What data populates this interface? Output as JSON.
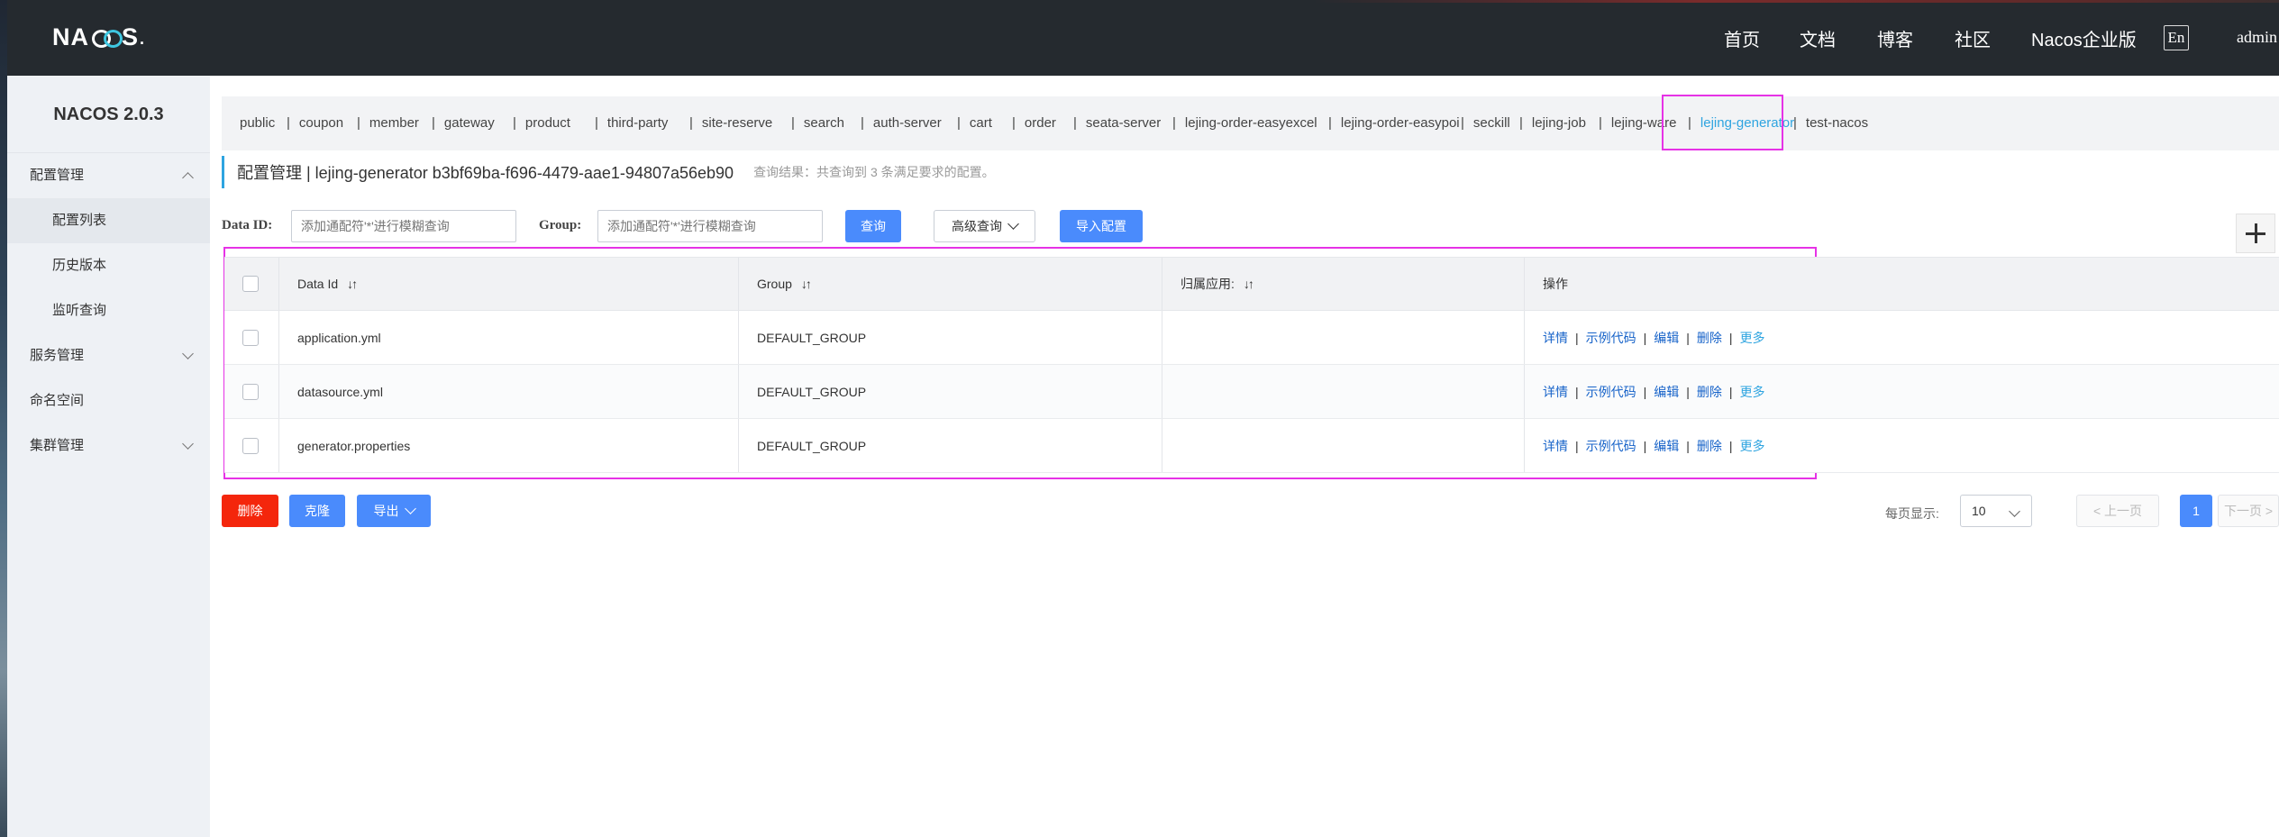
{
  "topbar": {
    "logo": "NACOS",
    "nav": [
      "首页",
      "文档",
      "博客",
      "社区",
      "Nacos企业版"
    ],
    "lang": "En",
    "user": "admin"
  },
  "sidebar": {
    "version": "NACOS 2.0.3",
    "items": [
      {
        "label": "配置管理"
      },
      {
        "label": "配置列表"
      },
      {
        "label": "历史版本"
      },
      {
        "label": "监听查询"
      },
      {
        "label": "服务管理"
      },
      {
        "label": "命名空间"
      },
      {
        "label": "集群管理"
      }
    ]
  },
  "namespaces": [
    "public",
    "coupon",
    "member",
    "gateway",
    "product",
    "third-party",
    "site-reserve",
    "search",
    "auth-server",
    "cart",
    "order",
    "seata-server",
    "lejing-order-easyexcel",
    "lejing-order-easypoi",
    "seckill",
    "lejing-job",
    "lejing-ware",
    "lejing-generator",
    "test-nacos"
  ],
  "active_namespace": "lejing-generator",
  "header": {
    "title": "配置管理 | lejing-generator  b3bf69ba-f696-4479-aae1-94807a56eb90",
    "hint": "查询结果：共查询到 3 条满足要求的配置。"
  },
  "filters": {
    "data_id_label": "Data ID:",
    "data_id_placeholder": "添加通配符'*'进行模糊查询",
    "group_label": "Group:",
    "group_placeholder": "添加通配符'*'进行模糊查询",
    "search_btn": "查询",
    "advanced_btn": "高级查询",
    "import_btn": "导入配置"
  },
  "table": {
    "columns": [
      "Data Id",
      "Group",
      "归属应用:",
      "操作"
    ],
    "rows": [
      {
        "data_id": "application.yml",
        "group": "DEFAULT_GROUP",
        "app": ""
      },
      {
        "data_id": "datasource.yml",
        "group": "DEFAULT_GROUP",
        "app": ""
      },
      {
        "data_id": "generator.properties",
        "group": "DEFAULT_GROUP",
        "app": ""
      }
    ],
    "ops": [
      "详情",
      "示例代码",
      "编辑",
      "删除",
      "更多"
    ]
  },
  "footer": {
    "delete_btn": "删除",
    "clone_btn": "克隆",
    "export_btn": "导出",
    "page_size_label": "每页显示:",
    "page_size": "10",
    "prev": "上一页",
    "current_page": "1",
    "next": "下一页"
  },
  "colors": {
    "topbar": "#252a2f",
    "primary": "#4a8bfc",
    "danger": "#f4260c",
    "link": "#1763c9",
    "accent": "#2ea4e0",
    "highlight": "#e632e6"
  }
}
